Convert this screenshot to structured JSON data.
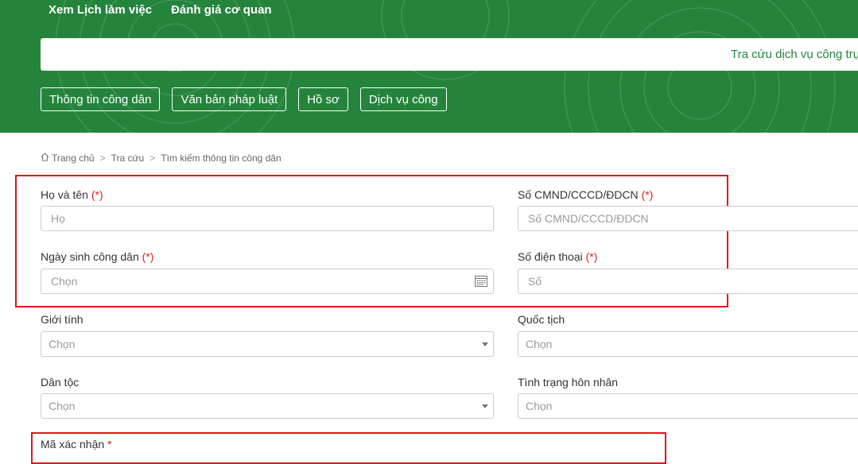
{
  "topnav": [
    "Xem Lịch làm việc",
    "Đánh giá cơ quan"
  ],
  "search": {
    "button_label": "Tra cứu dịch vụ công trực tuyến"
  },
  "categories": [
    "Thông tin công dân",
    "Văn bản pháp luật",
    "Hồ sơ",
    "Dịch vụ công"
  ],
  "breadcrumb": [
    "Trang chủ",
    "Tra cứu",
    "Tìm kiếm thông tin công dân"
  ],
  "form": {
    "required_mark": "(*)",
    "fields": {
      "ho_ten": {
        "label": "Họ và tên",
        "placeholder": "Họ"
      },
      "cmnd": {
        "label": "Số CMND/CCCD/ĐDCN",
        "placeholder": "Số CMND/CCCD/ĐDCN"
      },
      "ngay_sinh": {
        "label": "Ngày sinh công dân",
        "placeholder": "Chọn"
      },
      "so_dien_thoai": {
        "label": "Số điện thoại",
        "placeholder": "Số"
      },
      "gioi_tinh": {
        "label": "Giới tính",
        "placeholder": "Chọn"
      },
      "quoc_tich": {
        "label": "Quốc tịch",
        "placeholder": "Chọn"
      },
      "dan_toc": {
        "label": "Dân tộc",
        "placeholder": "Chọn"
      },
      "hon_nhan": {
        "label": "Tình trạng hôn nhân",
        "placeholder": "Chọn"
      }
    },
    "captcha": {
      "label": "Mã xác nhận",
      "required_mark": "*"
    }
  },
  "colors": {
    "header_green": "#24843c",
    "highlight_red": "#e3141b",
    "required_red": "#d9211f"
  },
  "icons": {
    "home": "home-icon",
    "calendar": "calendar-icon",
    "dropdown": "caret-down-icon"
  }
}
